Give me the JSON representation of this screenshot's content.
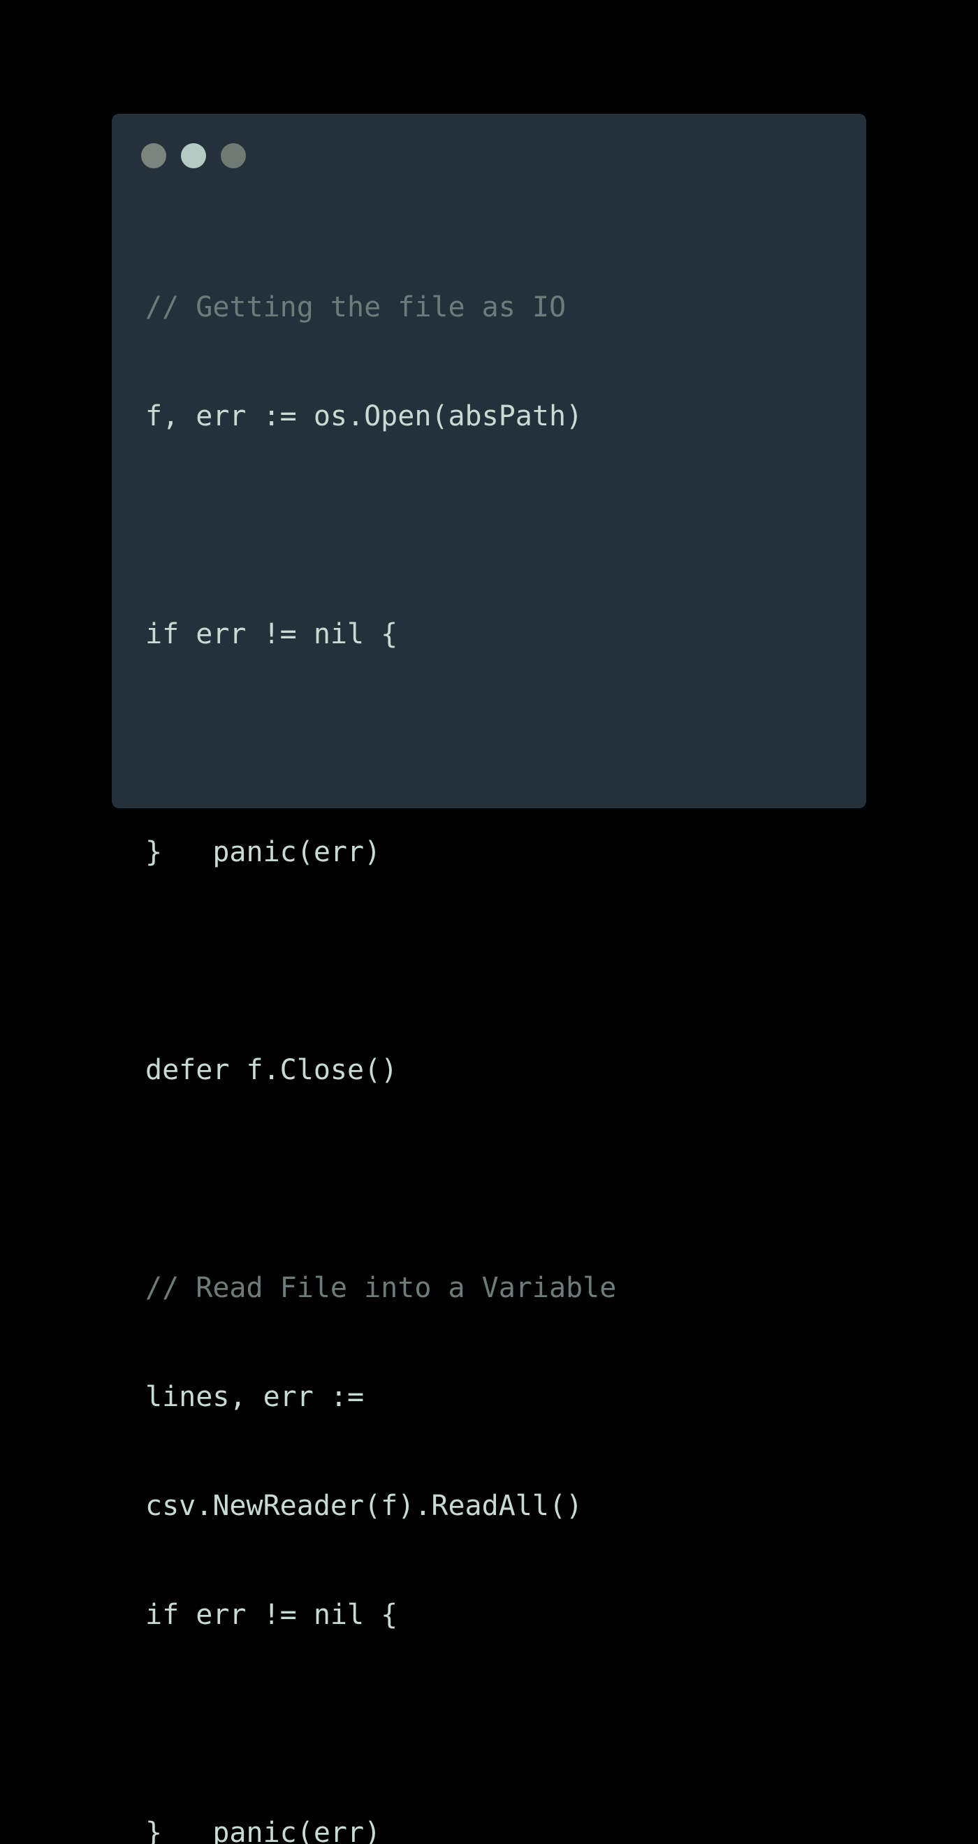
{
  "window": {
    "background": "#25313a",
    "buttons": [
      {
        "icon": "window-dot-icon",
        "color": "#7b847d"
      },
      {
        "icon": "window-dot-icon",
        "color": "#b3cbc2"
      },
      {
        "icon": "window-dot-icon",
        "color": "#6f7a73"
      }
    ]
  },
  "code": {
    "language": "Go",
    "comment_color": "#6d7c7a",
    "text_color": "#c7dbd3",
    "lines": [
      {
        "type": "comment",
        "text": "// Getting the file as IO"
      },
      {
        "type": "code",
        "text": "f, err := os.Open(absPath)"
      },
      {
        "type": "blank",
        "text": ""
      },
      {
        "type": "code",
        "text": "if err != nil {"
      },
      {
        "type": "blank",
        "text": ""
      },
      {
        "type": "code",
        "text": "}   panic(err)"
      },
      {
        "type": "blank",
        "text": ""
      },
      {
        "type": "code",
        "text": "defer f.Close()"
      },
      {
        "type": "blank",
        "text": ""
      },
      {
        "type": "comment",
        "text": "// Read File into a Variable"
      },
      {
        "type": "code",
        "text": "lines, err :="
      },
      {
        "type": "code",
        "text": "csv.NewReader(f).ReadAll()"
      },
      {
        "type": "code",
        "text": "if err != nil {"
      },
      {
        "type": "blank",
        "text": ""
      },
      {
        "type": "code",
        "text": "}   panic(err)"
      }
    ]
  }
}
